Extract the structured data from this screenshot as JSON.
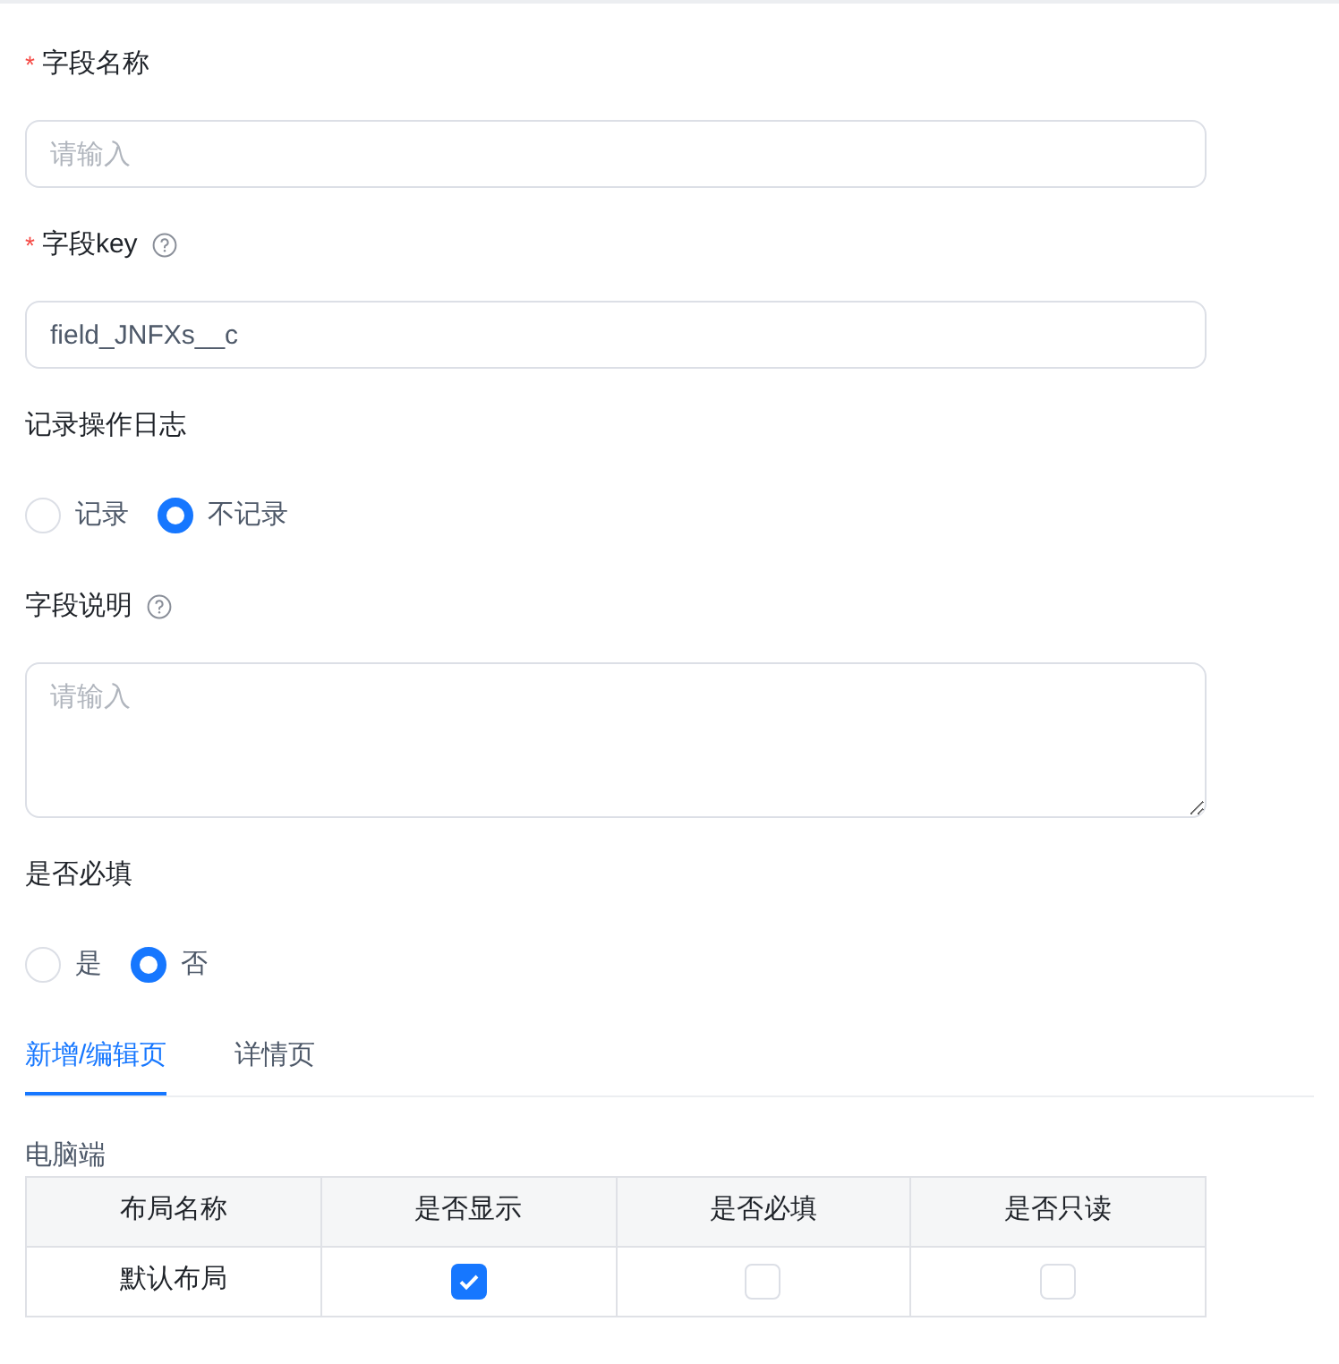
{
  "fields": [
    {
      "kind": "text",
      "label": "字段名称",
      "required": true,
      "help": false,
      "placeholder": "请输入"
    },
    {
      "kind": "text",
      "label": "字段key",
      "required": true,
      "help": true,
      "value": "field_JNFXs__c"
    },
    {
      "kind": "radio",
      "label": "记录操作日志",
      "required": false,
      "help": false,
      "options": [
        {
          "label": "记录",
          "selected": false
        },
        {
          "label": "不记录",
          "selected": true
        }
      ]
    },
    {
      "kind": "textarea",
      "label": "字段说明",
      "required": false,
      "help": true,
      "placeholder": "请输入"
    },
    {
      "kind": "radio",
      "label": "是否必填",
      "required": false,
      "help": false,
      "options": [
        {
          "label": "是",
          "selected": false
        },
        {
          "label": "否",
          "selected": true
        }
      ]
    }
  ],
  "tabs": [
    {
      "label": "新增/编辑页",
      "selected": true
    },
    {
      "label": "详情页",
      "selected": false
    }
  ],
  "section_title": "电脑端",
  "required_mark": "*",
  "table": {
    "columns": [
      "布局名称",
      "是否显示",
      "是否必填",
      "是否只读"
    ],
    "rows": [
      {
        "name": "默认布局",
        "visible": true,
        "required": false,
        "readonly": false
      }
    ]
  }
}
